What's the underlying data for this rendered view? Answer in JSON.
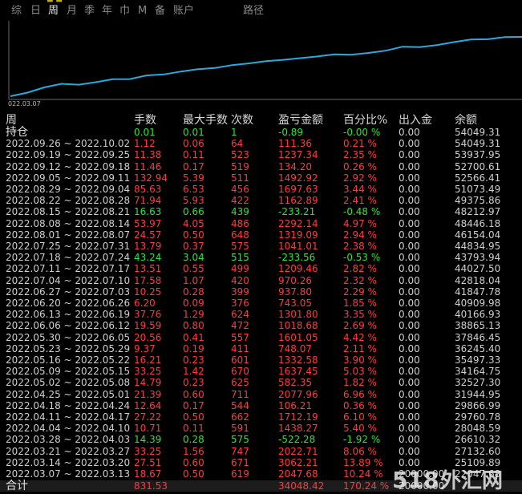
{
  "tabs": [
    {
      "label": "综",
      "active": false
    },
    {
      "label": "日",
      "active": false
    },
    {
      "label": "周",
      "active": true
    },
    {
      "label": "月",
      "active": false
    },
    {
      "label": "季",
      "active": false
    },
    {
      "label": "年",
      "active": false
    },
    {
      "label": "巾",
      "active": false
    },
    {
      "label": "M",
      "active": false
    },
    {
      "label": "备",
      "active": false
    },
    {
      "label": "账户",
      "active": false
    },
    {
      "label": "路径",
      "active": false
    }
  ],
  "chart": {
    "start_date": "022.03.07",
    "line_color": "#27a9e1",
    "axis_color": "#6a6a6a"
  },
  "table": {
    "headers": {
      "period": "周",
      "lots": "手数",
      "max_lots": "最大手数",
      "count": "次数",
      "pnl": "盈亏金额",
      "pct": "百分比%",
      "io": "出入金",
      "balance": "余额"
    },
    "holding": {
      "period": "持仓",
      "lots": "0.01",
      "max_lots": "0.01",
      "count": "1",
      "pnl": "-0.89",
      "pct": "-0.00 %",
      "io": "0.00",
      "balance": "54049.31",
      "color": "green"
    },
    "rows": [
      {
        "period": "2022.09.26 ~ 2022.10.02",
        "lots": "1.12",
        "max_lots": "0.06",
        "count": "64",
        "pnl": "111.36",
        "pct": "0.21 %",
        "io": "0.00",
        "balance": "54049.31",
        "color": "red"
      },
      {
        "period": "2022.09.19 ~ 2022.09.25",
        "lots": "11.38",
        "max_lots": "0.11",
        "count": "523",
        "pnl": "1237.34",
        "pct": "2.35 %",
        "io": "0.00",
        "balance": "53937.95",
        "color": "red"
      },
      {
        "period": "2022.09.12 ~ 2022.09.18",
        "lots": "11.46",
        "max_lots": "0.17",
        "count": "519",
        "pnl": "134.20",
        "pct": "0.26 %",
        "io": "0.00",
        "balance": "52700.61",
        "color": "red"
      },
      {
        "period": "2022.09.05 ~ 2022.09.11",
        "lots": "132.94",
        "max_lots": "5.39",
        "count": "511",
        "pnl": "1492.92",
        "pct": "2.92 %",
        "io": "0.00",
        "balance": "52566.41",
        "color": "red"
      },
      {
        "period": "2022.08.29 ~ 2022.09.04",
        "lots": "85.63",
        "max_lots": "6.53",
        "count": "456",
        "pnl": "1697.63",
        "pct": "3.44 %",
        "io": "0.00",
        "balance": "51073.49",
        "color": "red"
      },
      {
        "period": "2022.08.22 ~ 2022.08.28",
        "lots": "71.94",
        "max_lots": "5.93",
        "count": "422",
        "pnl": "1162.89",
        "pct": "2.41 %",
        "io": "0.00",
        "balance": "49375.86",
        "color": "red"
      },
      {
        "period": "2022.08.15 ~ 2022.08.21",
        "lots": "16.63",
        "max_lots": "0.66",
        "count": "439",
        "pnl": "-233.21",
        "pct": "-0.48 %",
        "io": "0.00",
        "balance": "48212.97",
        "color": "green"
      },
      {
        "period": "2022.08.08 ~ 2022.08.14",
        "lots": "53.97",
        "max_lots": "4.05",
        "count": "486",
        "pnl": "2292.14",
        "pct": "4.97 %",
        "io": "0.00",
        "balance": "48446.18",
        "color": "red"
      },
      {
        "period": "2022.08.01 ~ 2022.08.07",
        "lots": "24.57",
        "max_lots": "0.50",
        "count": "648",
        "pnl": "1319.09",
        "pct": "2.94 %",
        "io": "0.00",
        "balance": "46154.04",
        "color": "red"
      },
      {
        "period": "2022.07.25 ~ 2022.07.31",
        "lots": "13.79",
        "max_lots": "0.37",
        "count": "575",
        "pnl": "1041.01",
        "pct": "2.38 %",
        "io": "0.00",
        "balance": "44834.95",
        "color": "red"
      },
      {
        "period": "2022.07.18 ~ 2022.07.24",
        "lots": "43.24",
        "max_lots": "3.04",
        "count": "515",
        "pnl": "-233.56",
        "pct": "-0.53 %",
        "io": "0.00",
        "balance": "43793.94",
        "color": "green"
      },
      {
        "period": "2022.07.11 ~ 2022.07.17",
        "lots": "13.51",
        "max_lots": "0.55",
        "count": "499",
        "pnl": "1209.46",
        "pct": "2.82 %",
        "io": "0.00",
        "balance": "44027.50",
        "color": "red"
      },
      {
        "period": "2022.07.04 ~ 2022.07.10",
        "lots": "17.58",
        "max_lots": "1.07",
        "count": "420",
        "pnl": "970.26",
        "pct": "2.32 %",
        "io": "0.00",
        "balance": "42818.04",
        "color": "red"
      },
      {
        "period": "2022.06.27 ~ 2022.07.03",
        "lots": "10.25",
        "max_lots": "0.28",
        "count": "399",
        "pnl": "937.80",
        "pct": "2.29 %",
        "io": "0.00",
        "balance": "41847.78",
        "color": "red"
      },
      {
        "period": "2022.06.20 ~ 2022.06.26",
        "lots": "6.20",
        "max_lots": "0.09",
        "count": "376",
        "pnl": "743.05",
        "pct": "1.85 %",
        "io": "0.00",
        "balance": "40909.98",
        "color": "red"
      },
      {
        "period": "2022.06.13 ~ 2022.06.19",
        "lots": "37.76",
        "max_lots": "1.29",
        "count": "624",
        "pnl": "1301.80",
        "pct": "3.35 %",
        "io": "0.00",
        "balance": "40166.93",
        "color": "red"
      },
      {
        "period": "2022.06.06 ~ 2022.06.12",
        "lots": "19.59",
        "max_lots": "0.80",
        "count": "472",
        "pnl": "1018.68",
        "pct": "2.69 %",
        "io": "0.00",
        "balance": "38865.13",
        "color": "red"
      },
      {
        "period": "2022.05.30 ~ 2022.06.05",
        "lots": "20.56",
        "max_lots": "0.41",
        "count": "557",
        "pnl": "1601.05",
        "pct": "4.42 %",
        "io": "0.00",
        "balance": "37846.45",
        "color": "red"
      },
      {
        "period": "2022.05.23 ~ 2022.05.29",
        "lots": "9.37",
        "max_lots": "0.19",
        "count": "411",
        "pnl": "748.07",
        "pct": "2.11 %",
        "io": "0.00",
        "balance": "36245.40",
        "color": "red"
      },
      {
        "period": "2022.05.16 ~ 2022.05.22",
        "lots": "16.21",
        "max_lots": "0.23",
        "count": "601",
        "pnl": "1332.58",
        "pct": "3.90 %",
        "io": "0.00",
        "balance": "35497.33",
        "color": "red"
      },
      {
        "period": "2022.05.09 ~ 2022.05.15",
        "lots": "33.25",
        "max_lots": "1.42",
        "count": "670",
        "pnl": "1637.45",
        "pct": "5.03 %",
        "io": "0.00",
        "balance": "34164.75",
        "color": "red"
      },
      {
        "period": "2022.05.02 ~ 2022.05.08",
        "lots": "14.79",
        "max_lots": "0.23",
        "count": "625",
        "pnl": "582.35",
        "pct": "1.82 %",
        "io": "0.00",
        "balance": "32527.30",
        "color": "red"
      },
      {
        "period": "2022.04.25 ~ 2022.05.01",
        "lots": "21.39",
        "max_lots": "0.60",
        "count": "711",
        "pnl": "2077.96",
        "pct": "6.96 %",
        "io": "0.00",
        "balance": "31944.95",
        "color": "red"
      },
      {
        "period": "2022.04.18 ~ 2022.04.24",
        "lots": "12.64",
        "max_lots": "0.17",
        "count": "544",
        "pnl": "106.21",
        "pct": "0.36 %",
        "io": "0.00",
        "balance": "29866.99",
        "color": "red"
      },
      {
        "period": "2022.04.11 ~ 2022.04.17",
        "lots": "27.22",
        "max_lots": "0.50",
        "count": "662",
        "pnl": "1712.19",
        "pct": "6.10 %",
        "io": "0.00",
        "balance": "29760.78",
        "color": "red"
      },
      {
        "period": "2022.04.04 ~ 2022.04.10",
        "lots": "10.71",
        "max_lots": "0.11",
        "count": "591",
        "pnl": "1438.27",
        "pct": "5.40 %",
        "io": "0.00",
        "balance": "28048.59",
        "color": "red"
      },
      {
        "period": "2022.03.28 ~ 2022.04.03",
        "lots": "14.39",
        "max_lots": "0.28",
        "count": "575",
        "pnl": "-522.28",
        "pct": "-1.92 %",
        "io": "0.00",
        "balance": "26610.32",
        "color": "green"
      },
      {
        "period": "2022.03.21 ~ 2022.03.27",
        "lots": "33.25",
        "max_lots": "1.56",
        "count": "747",
        "pnl": "2022.71",
        "pct": "8.06 %",
        "io": "0.00",
        "balance": "27132.60",
        "color": "red"
      },
      {
        "period": "2022.03.14 ~ 2022.03.20",
        "lots": "27.51",
        "max_lots": "0.60",
        "count": "671",
        "pnl": "3062.21",
        "pct": "13.89 %",
        "io": "0.00",
        "balance": "25109.89",
        "color": "red"
      },
      {
        "period": "2022.03.07 ~ 2022.03.13",
        "lots": "18.67",
        "max_lots": "0.50",
        "count": "619",
        "pnl": "2047.68",
        "pct": "10.24 %",
        "io": "20000.00",
        "balance": "22047.68",
        "color": "red"
      }
    ],
    "total": {
      "period": "合计",
      "lots": "831.53",
      "max_lots": "",
      "count": "",
      "pnl": "34048.42",
      "pct": "170.24 %",
      "io": "20000.00",
      "balance": "",
      "color": "red"
    }
  },
  "watermark": {
    "text": "518外汇网",
    "color": "#e8e8e8",
    "accent": "#e53935"
  }
}
